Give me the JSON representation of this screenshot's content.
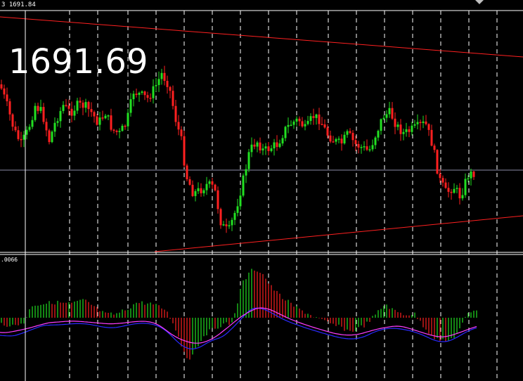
{
  "main_chart": {
    "header_price_label": "3 1691.84",
    "current_price_overlay": "1691.69"
  },
  "indicator": {
    "header_value_label": ".0066",
    "type": "MACD-style histogram with signal and main lines"
  },
  "colors": {
    "background": "#000000",
    "grid": "#ffffff",
    "bull_candle": "#22e022",
    "bear_candle": "#ff2020",
    "trendline": "#ff2020",
    "price_line": "#8a8aa6",
    "signal_line": "#ff3cff",
    "main_line": "#2a2aff"
  },
  "chart_data": {
    "type": "candlestick",
    "ohlc_close_series_approx": [
      1691.9,
      1691.85,
      1691.8,
      1691.76,
      1691.8,
      1691.82,
      1691.78,
      1691.82,
      1691.85,
      1691.83,
      1691.8,
      1691.86,
      1691.9,
      1691.86,
      1691.78,
      1691.6,
      1691.58,
      1691.56,
      1691.45,
      1691.42,
      1691.5,
      1691.62,
      1691.72,
      1691.75,
      1691.8,
      1691.82,
      1691.78,
      1691.76,
      1691.74,
      1691.72,
      1691.82,
      1691.78,
      1691.74,
      1691.64,
      1691.6,
      1691.62
    ],
    "horizontal_price_level": "1691.69",
    "macd_histogram_approx": [
      -0.1,
      -0.2,
      -0.15,
      0.1,
      0.15,
      0.2,
      0.1,
      0.05,
      0.05,
      0.1,
      0.15,
      0.2,
      0.15,
      -0.1,
      -0.3,
      -0.5,
      -0.4,
      -0.2,
      0.2,
      0.6,
      0.8,
      0.6,
      0.4,
      0.2,
      -0.05,
      -0.1,
      -0.15,
      -0.2,
      -0.1,
      0.1,
      0.2,
      0.05,
      -0.1,
      -0.3,
      -0.2,
      0.1
    ]
  }
}
